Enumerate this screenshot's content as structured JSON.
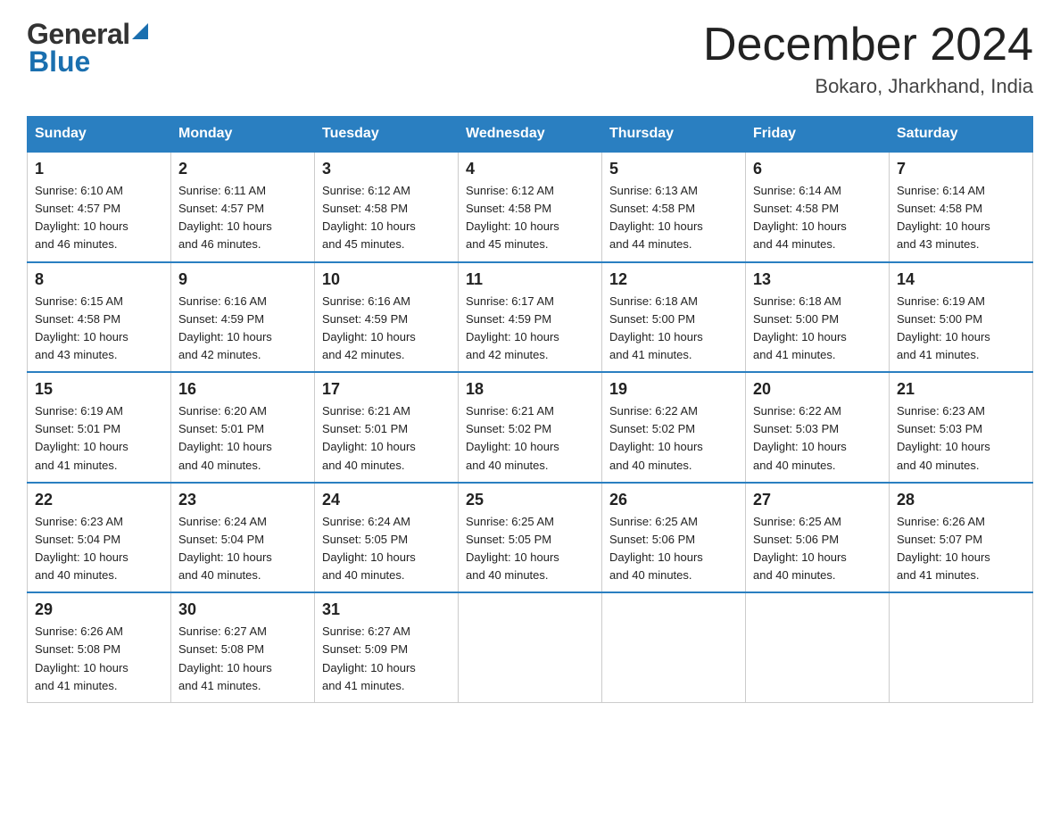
{
  "header": {
    "month_title": "December 2024",
    "location": "Bokaro, Jharkhand, India",
    "logo_general": "General",
    "logo_blue": "Blue"
  },
  "days_of_week": [
    "Sunday",
    "Monday",
    "Tuesday",
    "Wednesday",
    "Thursday",
    "Friday",
    "Saturday"
  ],
  "weeks": [
    [
      {
        "day": "1",
        "sunrise": "6:10 AM",
        "sunset": "4:57 PM",
        "daylight": "10 hours and 46 minutes."
      },
      {
        "day": "2",
        "sunrise": "6:11 AM",
        "sunset": "4:57 PM",
        "daylight": "10 hours and 46 minutes."
      },
      {
        "day": "3",
        "sunrise": "6:12 AM",
        "sunset": "4:58 PM",
        "daylight": "10 hours and 45 minutes."
      },
      {
        "day": "4",
        "sunrise": "6:12 AM",
        "sunset": "4:58 PM",
        "daylight": "10 hours and 45 minutes."
      },
      {
        "day": "5",
        "sunrise": "6:13 AM",
        "sunset": "4:58 PM",
        "daylight": "10 hours and 44 minutes."
      },
      {
        "day": "6",
        "sunrise": "6:14 AM",
        "sunset": "4:58 PM",
        "daylight": "10 hours and 44 minutes."
      },
      {
        "day": "7",
        "sunrise": "6:14 AM",
        "sunset": "4:58 PM",
        "daylight": "10 hours and 43 minutes."
      }
    ],
    [
      {
        "day": "8",
        "sunrise": "6:15 AM",
        "sunset": "4:58 PM",
        "daylight": "10 hours and 43 minutes."
      },
      {
        "day": "9",
        "sunrise": "6:16 AM",
        "sunset": "4:59 PM",
        "daylight": "10 hours and 42 minutes."
      },
      {
        "day": "10",
        "sunrise": "6:16 AM",
        "sunset": "4:59 PM",
        "daylight": "10 hours and 42 minutes."
      },
      {
        "day": "11",
        "sunrise": "6:17 AM",
        "sunset": "4:59 PM",
        "daylight": "10 hours and 42 minutes."
      },
      {
        "day": "12",
        "sunrise": "6:18 AM",
        "sunset": "5:00 PM",
        "daylight": "10 hours and 41 minutes."
      },
      {
        "day": "13",
        "sunrise": "6:18 AM",
        "sunset": "5:00 PM",
        "daylight": "10 hours and 41 minutes."
      },
      {
        "day": "14",
        "sunrise": "6:19 AM",
        "sunset": "5:00 PM",
        "daylight": "10 hours and 41 minutes."
      }
    ],
    [
      {
        "day": "15",
        "sunrise": "6:19 AM",
        "sunset": "5:01 PM",
        "daylight": "10 hours and 41 minutes."
      },
      {
        "day": "16",
        "sunrise": "6:20 AM",
        "sunset": "5:01 PM",
        "daylight": "10 hours and 40 minutes."
      },
      {
        "day": "17",
        "sunrise": "6:21 AM",
        "sunset": "5:01 PM",
        "daylight": "10 hours and 40 minutes."
      },
      {
        "day": "18",
        "sunrise": "6:21 AM",
        "sunset": "5:02 PM",
        "daylight": "10 hours and 40 minutes."
      },
      {
        "day": "19",
        "sunrise": "6:22 AM",
        "sunset": "5:02 PM",
        "daylight": "10 hours and 40 minutes."
      },
      {
        "day": "20",
        "sunrise": "6:22 AM",
        "sunset": "5:03 PM",
        "daylight": "10 hours and 40 minutes."
      },
      {
        "day": "21",
        "sunrise": "6:23 AM",
        "sunset": "5:03 PM",
        "daylight": "10 hours and 40 minutes."
      }
    ],
    [
      {
        "day": "22",
        "sunrise": "6:23 AM",
        "sunset": "5:04 PM",
        "daylight": "10 hours and 40 minutes."
      },
      {
        "day": "23",
        "sunrise": "6:24 AM",
        "sunset": "5:04 PM",
        "daylight": "10 hours and 40 minutes."
      },
      {
        "day": "24",
        "sunrise": "6:24 AM",
        "sunset": "5:05 PM",
        "daylight": "10 hours and 40 minutes."
      },
      {
        "day": "25",
        "sunrise": "6:25 AM",
        "sunset": "5:05 PM",
        "daylight": "10 hours and 40 minutes."
      },
      {
        "day": "26",
        "sunrise": "6:25 AM",
        "sunset": "5:06 PM",
        "daylight": "10 hours and 40 minutes."
      },
      {
        "day": "27",
        "sunrise": "6:25 AM",
        "sunset": "5:06 PM",
        "daylight": "10 hours and 40 minutes."
      },
      {
        "day": "28",
        "sunrise": "6:26 AM",
        "sunset": "5:07 PM",
        "daylight": "10 hours and 41 minutes."
      }
    ],
    [
      {
        "day": "29",
        "sunrise": "6:26 AM",
        "sunset": "5:08 PM",
        "daylight": "10 hours and 41 minutes."
      },
      {
        "day": "30",
        "sunrise": "6:27 AM",
        "sunset": "5:08 PM",
        "daylight": "10 hours and 41 minutes."
      },
      {
        "day": "31",
        "sunrise": "6:27 AM",
        "sunset": "5:09 PM",
        "daylight": "10 hours and 41 minutes."
      },
      {
        "day": "",
        "sunrise": "",
        "sunset": "",
        "daylight": ""
      },
      {
        "day": "",
        "sunrise": "",
        "sunset": "",
        "daylight": ""
      },
      {
        "day": "",
        "sunrise": "",
        "sunset": "",
        "daylight": ""
      },
      {
        "day": "",
        "sunrise": "",
        "sunset": "",
        "daylight": ""
      }
    ]
  ],
  "sunrise_label": "Sunrise:",
  "sunset_label": "Sunset:",
  "daylight_label": "Daylight:"
}
